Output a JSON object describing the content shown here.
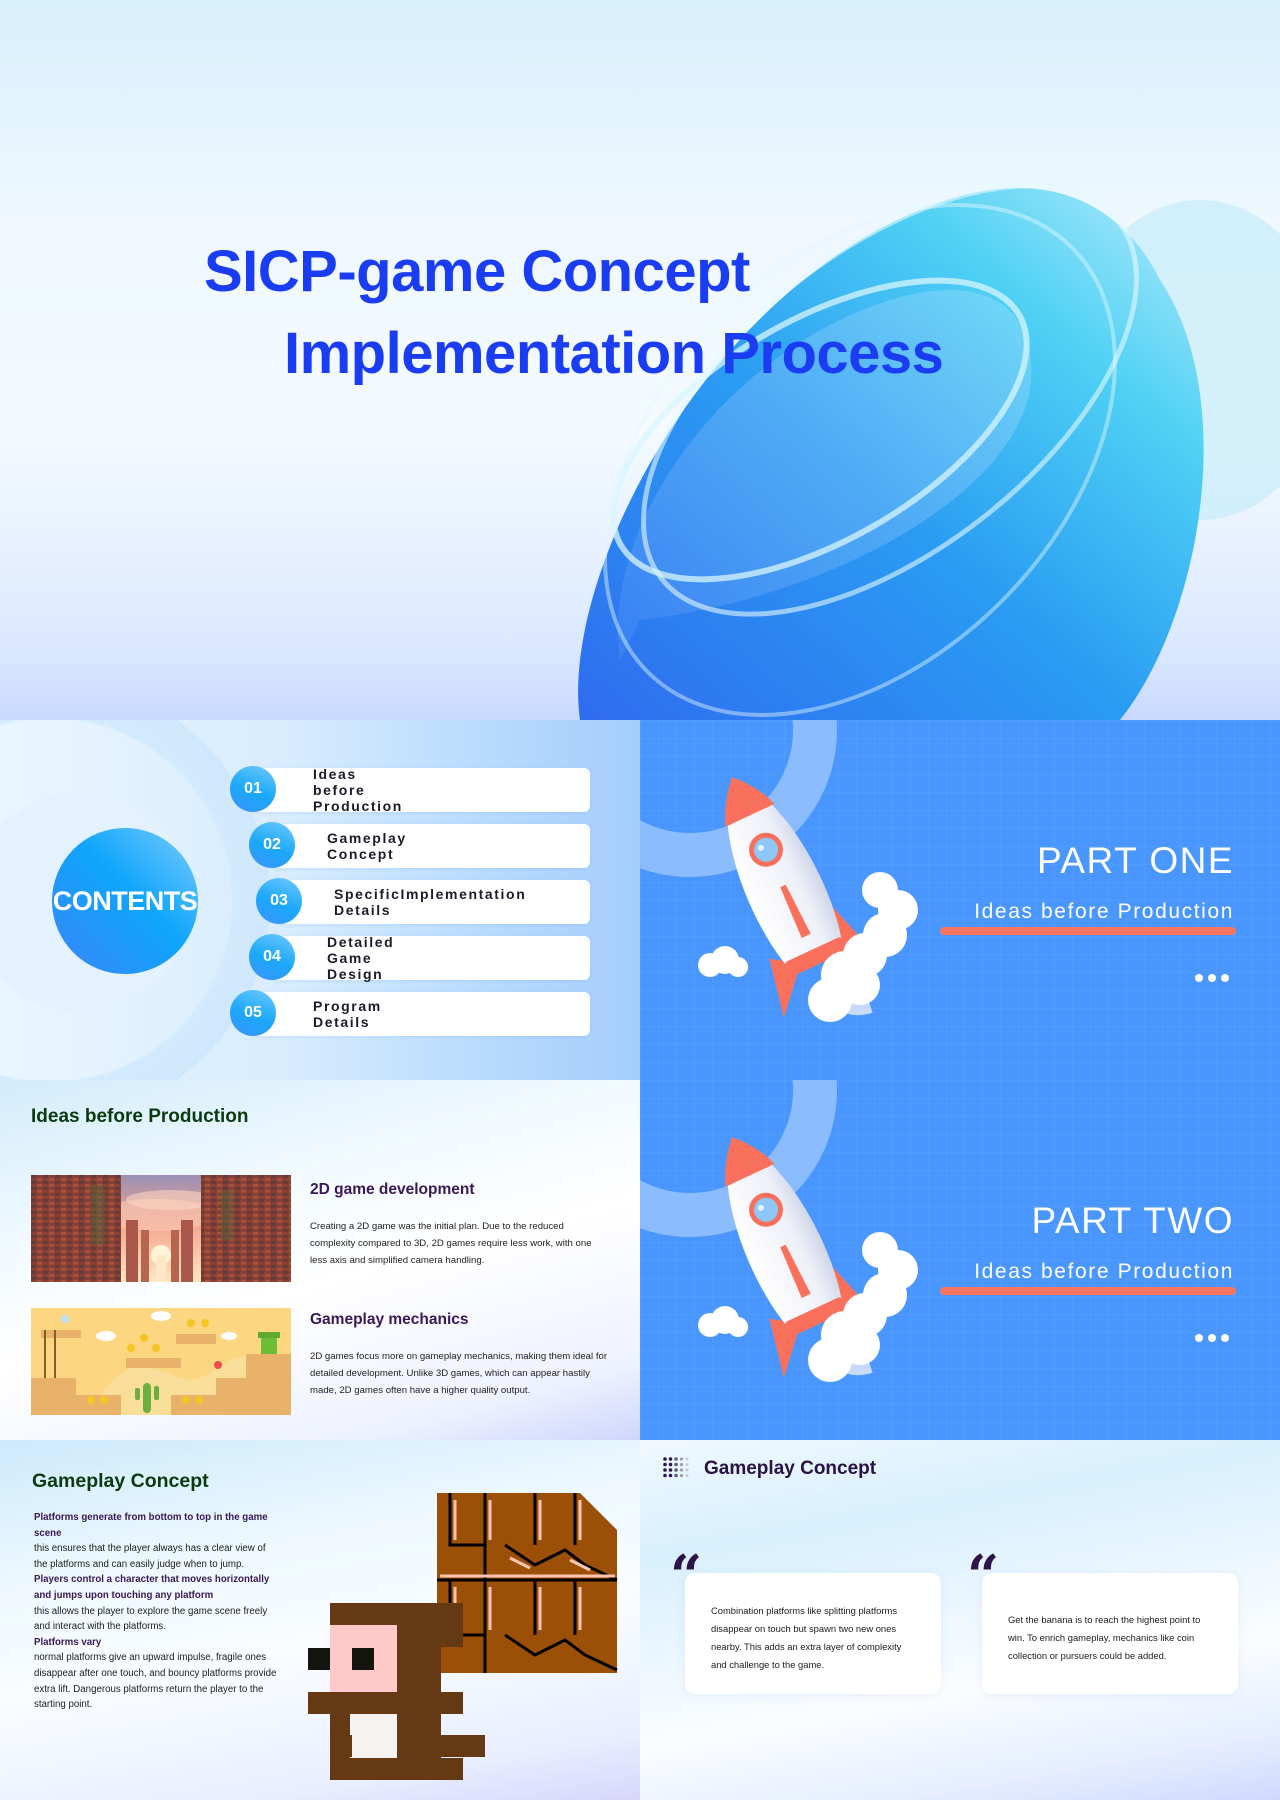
{
  "slides": {
    "title": {
      "line1": "SICP-game Concept",
      "line2": "Implementation Process",
      "title_color": "#1a3cf2"
    },
    "contents": {
      "heading": "CONTENTS",
      "items": [
        {
          "num": "01",
          "label": "Ideas before Production"
        },
        {
          "num": "02",
          "label": "Gameplay Concept"
        },
        {
          "num": "03",
          "label": "SpecificImplementation Details"
        },
        {
          "num": "04",
          "label": "Detailed Game Design"
        },
        {
          "num": "05",
          "label": "Program Details"
        }
      ]
    },
    "part_one": {
      "title": "PART ONE",
      "subtitle": "Ideas before Production",
      "illustration": "rocket-icon",
      "more": "more-dots-icon"
    },
    "part_two": {
      "title": "PART TWO",
      "subtitle": "Ideas before Production",
      "illustration": "rocket-icon",
      "more": "more-dots-icon"
    },
    "ideas": {
      "title": "Ideas before Production",
      "sections": [
        {
          "heading": "2D game development",
          "text": " Creating a 2D game was the initial plan. Due to the reduced complexity compared to 3D, 2D games require less work, with one less axis and simplified camera handling.",
          "image": "pixel-brick-canyon-sunset-image"
        },
        {
          "heading": "Gameplay mechanics",
          "text": " 2D games focus more on gameplay mechanics, making them ideal for detailed development. Unlike 3D games, which can appear hastily made, 2D games often have a higher quality output.",
          "image": "2d-platformer-level-image"
        }
      ]
    },
    "gameplay_left": {
      "title": "Gameplay Concept",
      "points": [
        {
          "bold": "Platforms generate from bottom to top in the game scene",
          "text": "this ensures that the player always has a clear view of the platforms and can easily judge when to jump."
        },
        {
          "bold": "Players control a character that moves horizontally and jumps upon touching any platform",
          "text": "this allows the player to explore the game scene freely and interact with the platforms."
        },
        {
          "bold": "Platforms vary",
          "text": "normal platforms give an upward impulse, fragile ones disappear after one touch, and bouncy platforms provide extra lift. Dangerous platforms return the player to the starting point."
        }
      ],
      "illustration": "pixel-monkey-and-brick-block"
    },
    "gameplay_right": {
      "title": "Gameplay Concept",
      "quote_mark": "“",
      "cards": [
        {
          "text": "Combination platforms like splitting platforms disappear on touch but spawn two new ones nearby. This adds an extra layer of complexity and challenge to the game."
        },
        {
          "text": "Get the banana is to reach the highest point to win. To enrich gameplay, mechanics like coin collection or pursuers could be added."
        }
      ]
    }
  },
  "colors": {
    "part_bg": "#4996fe",
    "accent_line": "#fb7561",
    "heading_green": "#0b3a0e",
    "heading_purple": "#3a1855"
  }
}
